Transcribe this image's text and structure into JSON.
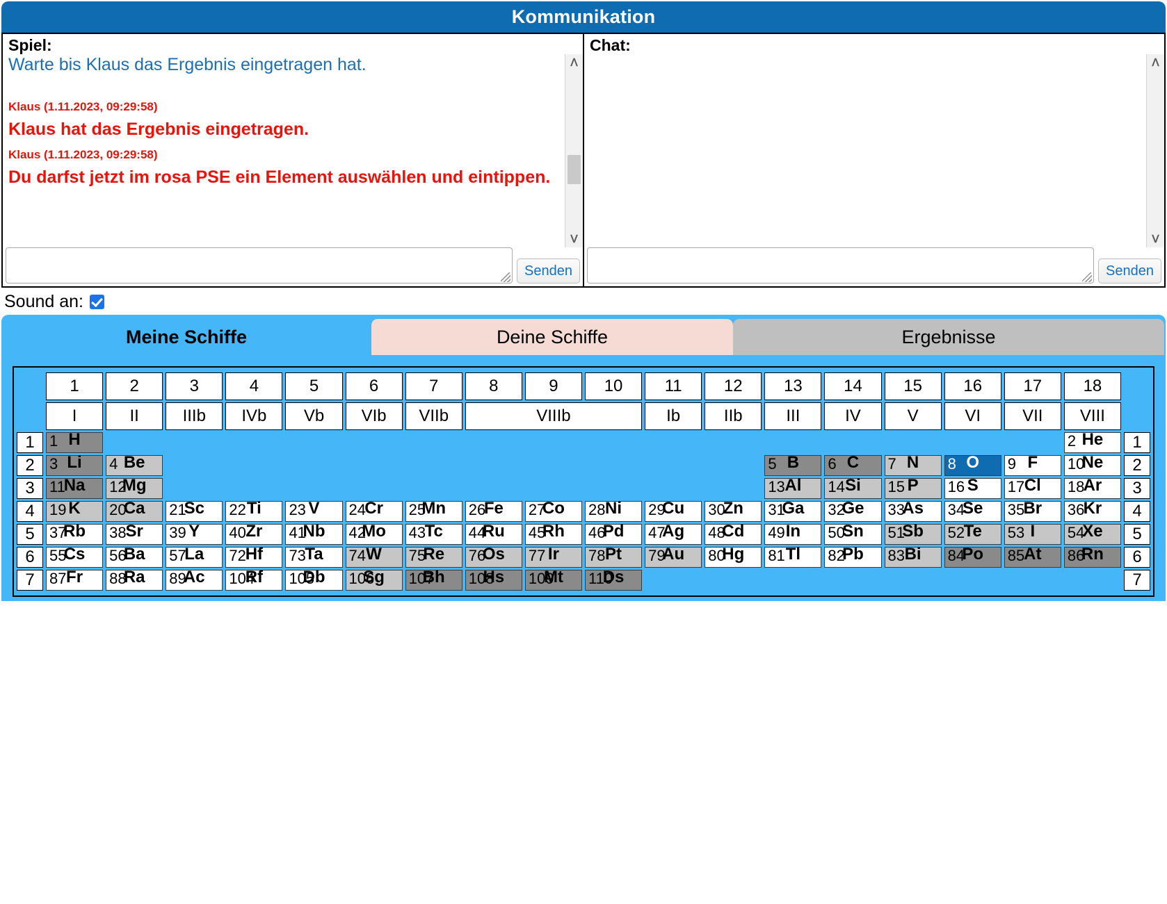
{
  "header": {
    "title": "Kommunikation"
  },
  "game_panel": {
    "label": "Spiel:",
    "info_message": "Warte bis Klaus das Ergebnis eingetragen hat.",
    "messages": [
      {
        "meta": "Klaus (1.11.2023, 09:29:58)",
        "text": "Klaus hat das Ergebnis eingetragen."
      },
      {
        "meta": "Klaus (1.11.2023, 09:29:58)",
        "text": "Du darfst jetzt im rosa PSE ein Element auswählen und eintippen."
      }
    ],
    "input_value": "",
    "input_placeholder": "",
    "send_label": "Senden"
  },
  "chat_panel": {
    "label": "Chat:",
    "messages": [],
    "input_value": "",
    "input_placeholder": "",
    "send_label": "Senden"
  },
  "sound": {
    "label": "Sound an:",
    "checked": true
  },
  "tabs": [
    {
      "label": "Meine Schiffe",
      "active": true,
      "color": "#45b6f7"
    },
    {
      "label": "Deine Schiffe",
      "active": false,
      "color": "#f5dbd4"
    },
    {
      "label": "Ergebnisse",
      "active": false,
      "color": "#bfbfbf"
    }
  ],
  "colors": {
    "board_background": "#45b6f7",
    "header_blue": "#0f6cb0",
    "hit_blue": "#0f6cb0",
    "cell_white": "#ffffff",
    "cell_light_gray": "#c6c6c6",
    "cell_dark_gray": "#8a8a8a",
    "message_red": "#e8140c",
    "info_blue": "#1a6fb5"
  },
  "pse": {
    "group_numbers": [
      "1",
      "2",
      "3",
      "4",
      "5",
      "6",
      "7",
      "8",
      "9",
      "10",
      "11",
      "12",
      "13",
      "14",
      "15",
      "16",
      "17",
      "18"
    ],
    "group_roman": [
      {
        "label": "I",
        "span": 1
      },
      {
        "label": "II",
        "span": 1
      },
      {
        "label": "IIIb",
        "span": 1
      },
      {
        "label": "IVb",
        "span": 1
      },
      {
        "label": "Vb",
        "span": 1
      },
      {
        "label": "VIb",
        "span": 1
      },
      {
        "label": "VIIb",
        "span": 1
      },
      {
        "label": "VIIIb",
        "span": 3
      },
      {
        "label": "Ib",
        "span": 1
      },
      {
        "label": "IIb",
        "span": 1
      },
      {
        "label": "III",
        "span": 1
      },
      {
        "label": "IV",
        "span": 1
      },
      {
        "label": "V",
        "span": 1
      },
      {
        "label": "VI",
        "span": 1
      },
      {
        "label": "VII",
        "span": 1
      },
      {
        "label": "VIII",
        "span": 1
      }
    ],
    "period_labels": [
      "1",
      "2",
      "3",
      "4",
      "5",
      "6",
      "7"
    ],
    "rows": [
      {
        "period": "1",
        "cells": [
          {
            "z": "1",
            "sym": "H",
            "state": "dark"
          },
          {
            "z": "",
            "sym": "",
            "state": "empty"
          },
          {
            "z": "",
            "sym": "",
            "state": "empty"
          },
          {
            "z": "",
            "sym": "",
            "state": "empty"
          },
          {
            "z": "",
            "sym": "",
            "state": "empty"
          },
          {
            "z": "",
            "sym": "",
            "state": "empty"
          },
          {
            "z": "",
            "sym": "",
            "state": "empty"
          },
          {
            "z": "",
            "sym": "",
            "state": "empty"
          },
          {
            "z": "",
            "sym": "",
            "state": "empty"
          },
          {
            "z": "",
            "sym": "",
            "state": "empty"
          },
          {
            "z": "",
            "sym": "",
            "state": "empty"
          },
          {
            "z": "",
            "sym": "",
            "state": "empty"
          },
          {
            "z": "",
            "sym": "",
            "state": "empty"
          },
          {
            "z": "",
            "sym": "",
            "state": "empty"
          },
          {
            "z": "",
            "sym": "",
            "state": "empty"
          },
          {
            "z": "",
            "sym": "",
            "state": "empty"
          },
          {
            "z": "",
            "sym": "",
            "state": "empty"
          },
          {
            "z": "2",
            "sym": "He",
            "state": "white"
          }
        ]
      },
      {
        "period": "2",
        "cells": [
          {
            "z": "3",
            "sym": "Li",
            "state": "dark"
          },
          {
            "z": "4",
            "sym": "Be",
            "state": "light"
          },
          {
            "z": "",
            "sym": "",
            "state": "empty"
          },
          {
            "z": "",
            "sym": "",
            "state": "empty"
          },
          {
            "z": "",
            "sym": "",
            "state": "empty"
          },
          {
            "z": "",
            "sym": "",
            "state": "empty"
          },
          {
            "z": "",
            "sym": "",
            "state": "empty"
          },
          {
            "z": "",
            "sym": "",
            "state": "empty"
          },
          {
            "z": "",
            "sym": "",
            "state": "empty"
          },
          {
            "z": "",
            "sym": "",
            "state": "empty"
          },
          {
            "z": "",
            "sym": "",
            "state": "empty"
          },
          {
            "z": "",
            "sym": "",
            "state": "empty"
          },
          {
            "z": "5",
            "sym": "B",
            "state": "dark"
          },
          {
            "z": "6",
            "sym": "C",
            "state": "dark"
          },
          {
            "z": "7",
            "sym": "N",
            "state": "light"
          },
          {
            "z": "8",
            "sym": "O",
            "state": "blue"
          },
          {
            "z": "9",
            "sym": "F",
            "state": "white"
          },
          {
            "z": "10",
            "sym": "Ne",
            "state": "white"
          }
        ]
      },
      {
        "period": "3",
        "cells": [
          {
            "z": "11",
            "sym": "Na",
            "state": "dark"
          },
          {
            "z": "12",
            "sym": "Mg",
            "state": "light"
          },
          {
            "z": "",
            "sym": "",
            "state": "empty"
          },
          {
            "z": "",
            "sym": "",
            "state": "empty"
          },
          {
            "z": "",
            "sym": "",
            "state": "empty"
          },
          {
            "z": "",
            "sym": "",
            "state": "empty"
          },
          {
            "z": "",
            "sym": "",
            "state": "empty"
          },
          {
            "z": "",
            "sym": "",
            "state": "empty"
          },
          {
            "z": "",
            "sym": "",
            "state": "empty"
          },
          {
            "z": "",
            "sym": "",
            "state": "empty"
          },
          {
            "z": "",
            "sym": "",
            "state": "empty"
          },
          {
            "z": "",
            "sym": "",
            "state": "empty"
          },
          {
            "z": "13",
            "sym": "Al",
            "state": "light"
          },
          {
            "z": "14",
            "sym": "Si",
            "state": "light"
          },
          {
            "z": "15",
            "sym": "P",
            "state": "light"
          },
          {
            "z": "16",
            "sym": "S",
            "state": "white"
          },
          {
            "z": "17",
            "sym": "Cl",
            "state": "white"
          },
          {
            "z": "18",
            "sym": "Ar",
            "state": "white"
          }
        ]
      },
      {
        "period": "4",
        "cells": [
          {
            "z": "19",
            "sym": "K",
            "state": "light"
          },
          {
            "z": "20",
            "sym": "Ca",
            "state": "light"
          },
          {
            "z": "21",
            "sym": "Sc",
            "state": "white"
          },
          {
            "z": "22",
            "sym": "Ti",
            "state": "white"
          },
          {
            "z": "23",
            "sym": "V",
            "state": "white"
          },
          {
            "z": "24",
            "sym": "Cr",
            "state": "white"
          },
          {
            "z": "25",
            "sym": "Mn",
            "state": "white"
          },
          {
            "z": "26",
            "sym": "Fe",
            "state": "white"
          },
          {
            "z": "27",
            "sym": "Co",
            "state": "white"
          },
          {
            "z": "28",
            "sym": "Ni",
            "state": "white"
          },
          {
            "z": "29",
            "sym": "Cu",
            "state": "white"
          },
          {
            "z": "30",
            "sym": "Zn",
            "state": "white"
          },
          {
            "z": "31",
            "sym": "Ga",
            "state": "white"
          },
          {
            "z": "32",
            "sym": "Ge",
            "state": "white"
          },
          {
            "z": "33",
            "sym": "As",
            "state": "white"
          },
          {
            "z": "34",
            "sym": "Se",
            "state": "white"
          },
          {
            "z": "35",
            "sym": "Br",
            "state": "white"
          },
          {
            "z": "36",
            "sym": "Kr",
            "state": "white"
          }
        ]
      },
      {
        "period": "5",
        "cells": [
          {
            "z": "37",
            "sym": "Rb",
            "state": "white"
          },
          {
            "z": "38",
            "sym": "Sr",
            "state": "white"
          },
          {
            "z": "39",
            "sym": "Y",
            "state": "white"
          },
          {
            "z": "40",
            "sym": "Zr",
            "state": "white"
          },
          {
            "z": "41",
            "sym": "Nb",
            "state": "white"
          },
          {
            "z": "42",
            "sym": "Mo",
            "state": "white"
          },
          {
            "z": "43",
            "sym": "Tc",
            "state": "white"
          },
          {
            "z": "44",
            "sym": "Ru",
            "state": "white"
          },
          {
            "z": "45",
            "sym": "Rh",
            "state": "white"
          },
          {
            "z": "46",
            "sym": "Pd",
            "state": "white"
          },
          {
            "z": "47",
            "sym": "Ag",
            "state": "white"
          },
          {
            "z": "48",
            "sym": "Cd",
            "state": "white"
          },
          {
            "z": "49",
            "sym": "In",
            "state": "white"
          },
          {
            "z": "50",
            "sym": "Sn",
            "state": "white"
          },
          {
            "z": "51",
            "sym": "Sb",
            "state": "light"
          },
          {
            "z": "52",
            "sym": "Te",
            "state": "light"
          },
          {
            "z": "53",
            "sym": "I",
            "state": "light"
          },
          {
            "z": "54",
            "sym": "Xe",
            "state": "light"
          }
        ]
      },
      {
        "period": "6",
        "cells": [
          {
            "z": "55",
            "sym": "Cs",
            "state": "white"
          },
          {
            "z": "56",
            "sym": "Ba",
            "state": "white"
          },
          {
            "z": "57",
            "sym": "La",
            "state": "white"
          },
          {
            "z": "72",
            "sym": "Hf",
            "state": "white"
          },
          {
            "z": "73",
            "sym": "Ta",
            "state": "white"
          },
          {
            "z": "74",
            "sym": "W",
            "state": "light"
          },
          {
            "z": "75",
            "sym": "Re",
            "state": "light"
          },
          {
            "z": "76",
            "sym": "Os",
            "state": "light"
          },
          {
            "z": "77",
            "sym": "Ir",
            "state": "light"
          },
          {
            "z": "78",
            "sym": "Pt",
            "state": "light"
          },
          {
            "z": "79",
            "sym": "Au",
            "state": "light"
          },
          {
            "z": "80",
            "sym": "Hg",
            "state": "white"
          },
          {
            "z": "81",
            "sym": "Tl",
            "state": "white"
          },
          {
            "z": "82",
            "sym": "Pb",
            "state": "white"
          },
          {
            "z": "83",
            "sym": "Bi",
            "state": "light"
          },
          {
            "z": "84",
            "sym": "Po",
            "state": "dark"
          },
          {
            "z": "85",
            "sym": "At",
            "state": "dark"
          },
          {
            "z": "86",
            "sym": "Rn",
            "state": "dark"
          }
        ]
      },
      {
        "period": "7",
        "cells": [
          {
            "z": "87",
            "sym": "Fr",
            "state": "white"
          },
          {
            "z": "88",
            "sym": "Ra",
            "state": "white"
          },
          {
            "z": "89",
            "sym": "Ac",
            "state": "white"
          },
          {
            "z": "104",
            "sym": "Rf",
            "state": "white"
          },
          {
            "z": "105",
            "sym": "Db",
            "state": "white"
          },
          {
            "z": "106",
            "sym": "Sg",
            "state": "light"
          },
          {
            "z": "107",
            "sym": "Bh",
            "state": "dark"
          },
          {
            "z": "108",
            "sym": "Hs",
            "state": "dark"
          },
          {
            "z": "109",
            "sym": "Mt",
            "state": "dark"
          },
          {
            "z": "110",
            "sym": "Ds",
            "state": "dark"
          },
          {
            "z": "",
            "sym": "",
            "state": "empty"
          },
          {
            "z": "",
            "sym": "",
            "state": "empty"
          },
          {
            "z": "",
            "sym": "",
            "state": "empty"
          },
          {
            "z": "",
            "sym": "",
            "state": "empty"
          },
          {
            "z": "",
            "sym": "",
            "state": "empty"
          },
          {
            "z": "",
            "sym": "",
            "state": "empty"
          },
          {
            "z": "",
            "sym": "",
            "state": "empty"
          },
          {
            "z": "",
            "sym": "",
            "state": "empty"
          }
        ]
      }
    ]
  }
}
